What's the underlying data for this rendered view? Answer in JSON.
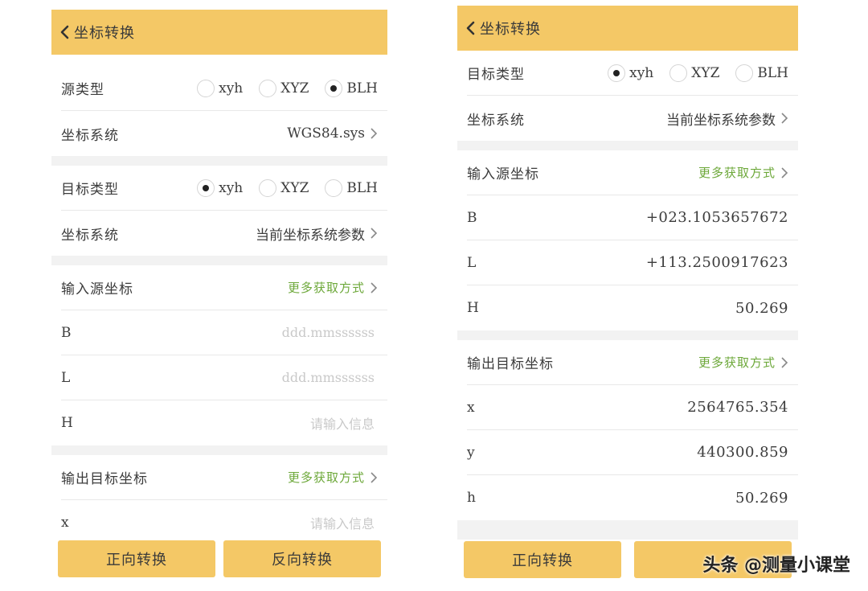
{
  "left": {
    "header": {
      "title": "坐标转换"
    },
    "source": {
      "type_label": "源类型",
      "options": [
        "xyh",
        "XYZ",
        "BLH"
      ],
      "selected": "BLH",
      "system_label": "坐标系统",
      "system_value": "WGS84.sys"
    },
    "target": {
      "type_label": "目标类型",
      "options": [
        "xyh",
        "XYZ",
        "BLH"
      ],
      "selected": "xyh",
      "system_label": "坐标系统",
      "system_value": "当前坐标系统参数"
    },
    "input": {
      "title": "输入源坐标",
      "more": "更多获取方式",
      "rows": [
        {
          "label": "B",
          "placeholder": "ddd.mmssssss"
        },
        {
          "label": "L",
          "placeholder": "ddd.mmssssss"
        },
        {
          "label": "H",
          "placeholder": "请输入信息"
        }
      ]
    },
    "output": {
      "title": "输出目标坐标",
      "more": "更多获取方式",
      "rows": [
        {
          "label": "x",
          "placeholder": "请输入信息"
        }
      ]
    },
    "buttons": {
      "forward": "正向转换",
      "reverse": "反向转换"
    }
  },
  "right": {
    "header": {
      "title": "坐标转换"
    },
    "target": {
      "type_label": "目标类型",
      "options": [
        "xyh",
        "XYZ",
        "BLH"
      ],
      "selected": "xyh",
      "system_label": "坐标系统",
      "system_value": "当前坐标系统参数"
    },
    "input": {
      "title": "输入源坐标",
      "more": "更多获取方式",
      "rows": [
        {
          "label": "B",
          "value": "+023.1053657672"
        },
        {
          "label": "L",
          "value": "+113.2500917623"
        },
        {
          "label": "H",
          "value": "50.269"
        }
      ]
    },
    "output": {
      "title": "输出目标坐标",
      "more": "更多获取方式",
      "rows": [
        {
          "label": "x",
          "value": "2564765.354"
        },
        {
          "label": "y",
          "value": "440300.859"
        },
        {
          "label": "h",
          "value": "50.269"
        }
      ]
    },
    "buttons": {
      "forward": "正向转换"
    }
  },
  "watermark": "头条 @测量小课堂",
  "colors": {
    "header": "#f4c866",
    "button": "#f4c866",
    "link": "#6da83a"
  },
  "icons": {
    "back": "chevron-left-icon",
    "disclosure": "chevron-right-icon"
  }
}
